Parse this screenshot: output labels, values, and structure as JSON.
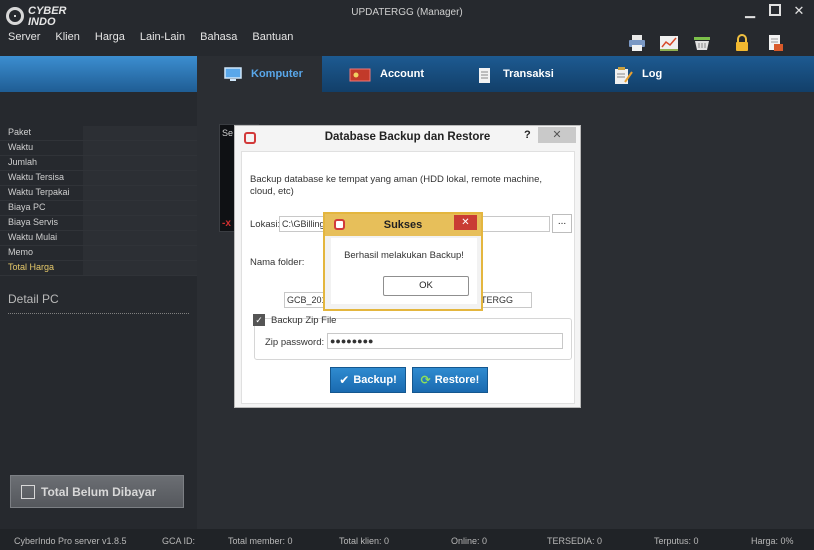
{
  "app": {
    "logo_line1": "CYBER",
    "logo_line2": "INDO",
    "title": "UPDATERGG (Manager)",
    "window_controls": [
      "minimize",
      "maximize",
      "close"
    ]
  },
  "menu": [
    "Server",
    "Klien",
    "Harga",
    "Lain-Lain",
    "Bahasa",
    "Bantuan"
  ],
  "toolbar_icons": [
    "printer-icon",
    "chart-icon",
    "basket-icon",
    "lock-icon",
    "report-icon"
  ],
  "tabs": [
    {
      "label": "Komputer",
      "icon": "monitor-icon",
      "active": true
    },
    {
      "label": "Account",
      "icon": "account-card-icon",
      "active": false
    },
    {
      "label": "Transaksi",
      "icon": "receipt-icon",
      "active": false
    },
    {
      "label": "Log",
      "icon": "clipboard-icon",
      "active": false
    }
  ],
  "left_panel": {
    "rows": [
      {
        "label": "Paket"
      },
      {
        "label": "Waktu"
      },
      {
        "label": "Jumlah"
      },
      {
        "label": "Waktu Tersisa"
      },
      {
        "label": "Waktu Terpakai"
      },
      {
        "label": "Biaya PC"
      },
      {
        "label": "Biaya Servis"
      },
      {
        "label": "Waktu Mulai"
      },
      {
        "label": "Memo"
      },
      {
        "label": "Total Harga",
        "highlight": true
      }
    ],
    "detail_title": "Detail PC",
    "unpaid_button": "Total Belum Dibayar"
  },
  "background_panel": {
    "title": "Se",
    "marker": "-x"
  },
  "backup_dialog": {
    "title": "Database Backup dan Restore",
    "help": "?",
    "close": "✕",
    "description": "Backup database ke tempat yang aman (HDD lokal, remote machine, cloud, etc)",
    "location_label": "Lokasi:",
    "location_value": "C:\\GBillingS",
    "browse_label": "...",
    "folder_label": "Nama folder:",
    "folder_value_left": "GCB_2016",
    "folder_value_right": "TERGG",
    "zip_checkbox_label": "Backup Zip File",
    "zip_checked": true,
    "zip_password_label": "Zip password:",
    "zip_password_value": "●●●●●●●●",
    "backup_button": "Backup!",
    "restore_button": "Restore!"
  },
  "success_dialog": {
    "title": "Sukses",
    "close": "✕",
    "message": "Berhasil melakukan Backup!",
    "ok_button": "OK"
  },
  "status_bar": {
    "version": "CyberIndo Pro server v1.8.5",
    "gca": "GCA ID:",
    "total_member": "Total member: 0",
    "total_klien": "Total klien: 0",
    "online": "Online: 0",
    "tersedia": "TERSEDIA: 0",
    "terputus": "Terputus: 0",
    "harga": "Harga: 0%"
  }
}
